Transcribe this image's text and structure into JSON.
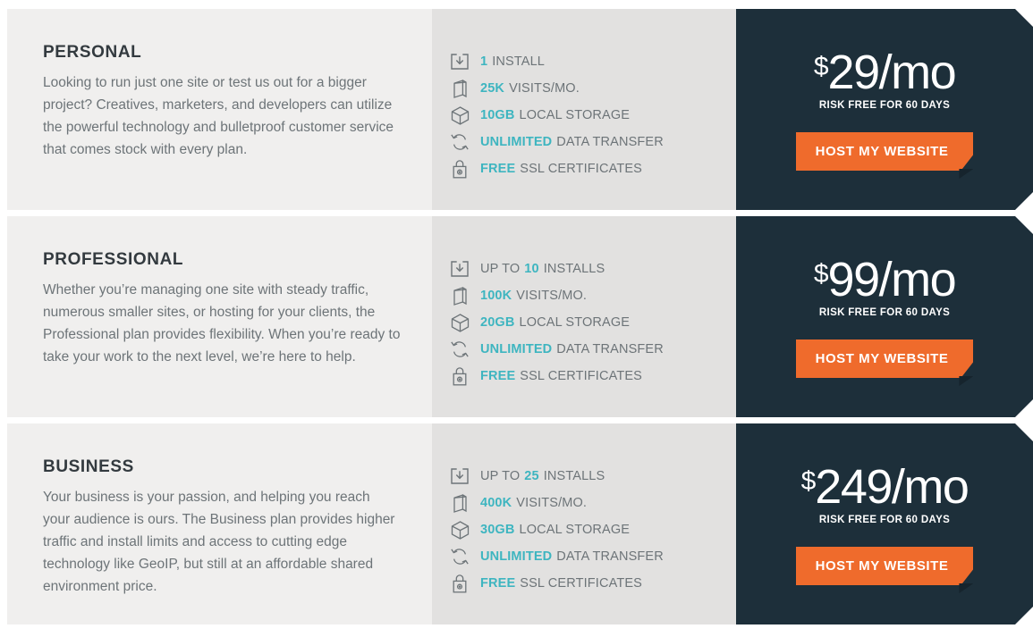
{
  "colors": {
    "desc_bg": "#f0efee",
    "features_bg": "#e2e1e0",
    "price_bg": "#1d2f3a",
    "accent_teal": "#3eb5c0",
    "accent_orange": "#ef6b2c",
    "heading": "#333a3f",
    "body_text": "#6d7478"
  },
  "plans": [
    {
      "name": "PERSONAL",
      "description": "Looking to run just one site or test us out for a bigger project? Creatives, marketers, and developers can utilize the powerful technology and bulletproof customer service that comes stock with every plan.",
      "features": [
        {
          "icon": "download-icon",
          "prefix": "",
          "highlight": "1",
          "rest": "INSTALL"
        },
        {
          "icon": "server-icon",
          "prefix": "",
          "highlight": "25K",
          "rest": "VISITS/MO."
        },
        {
          "icon": "cube-icon",
          "prefix": "",
          "highlight": "10GB",
          "rest": "LOCAL STORAGE"
        },
        {
          "icon": "refresh-icon",
          "prefix": "",
          "highlight": "UNLIMITED",
          "rest": "DATA TRANSFER"
        },
        {
          "icon": "lock-icon",
          "prefix": "",
          "highlight": "FREE",
          "rest": "SSL CERTIFICATES"
        }
      ],
      "currency": "$",
      "price": "29/mo",
      "guarantee": "RISK FREE FOR 60 DAYS",
      "cta_label": "HOST MY WEBSITE"
    },
    {
      "name": "PROFESSIONAL",
      "description": "Whether you’re managing one site with steady traffic, numerous smaller sites, or hosting for your clients, the Professional plan provides flexibility. When you’re ready to take your work to the next level, we’re here to help.",
      "features": [
        {
          "icon": "download-icon",
          "prefix": "UP TO",
          "highlight": "10",
          "rest": "INSTALLS"
        },
        {
          "icon": "server-icon",
          "prefix": "",
          "highlight": "100K",
          "rest": "VISITS/MO."
        },
        {
          "icon": "cube-icon",
          "prefix": "",
          "highlight": "20GB",
          "rest": "LOCAL STORAGE"
        },
        {
          "icon": "refresh-icon",
          "prefix": "",
          "highlight": "UNLIMITED",
          "rest": "DATA TRANSFER"
        },
        {
          "icon": "lock-icon",
          "prefix": "",
          "highlight": "FREE",
          "rest": "SSL CERTIFICATES"
        }
      ],
      "currency": "$",
      "price": "99/mo",
      "guarantee": "RISK FREE FOR 60 DAYS",
      "cta_label": "HOST MY WEBSITE"
    },
    {
      "name": "BUSINESS",
      "description": "Your business is your passion, and helping you reach your audience is ours. The Business plan provides higher traffic and install limits and access to cutting edge technology like GeoIP, but still at an affordable shared environment price.",
      "features": [
        {
          "icon": "download-icon",
          "prefix": "UP TO",
          "highlight": "25",
          "rest": "INSTALLS"
        },
        {
          "icon": "server-icon",
          "prefix": "",
          "highlight": "400K",
          "rest": "VISITS/MO."
        },
        {
          "icon": "cube-icon",
          "prefix": "",
          "highlight": "30GB",
          "rest": "LOCAL STORAGE"
        },
        {
          "icon": "refresh-icon",
          "prefix": "",
          "highlight": "UNLIMITED",
          "rest": "DATA TRANSFER"
        },
        {
          "icon": "lock-icon",
          "prefix": "",
          "highlight": "FREE",
          "rest": "SSL CERTIFICATES"
        }
      ],
      "currency": "$",
      "price": "249/mo",
      "guarantee": "RISK FREE FOR 60 DAYS",
      "cta_label": "HOST MY WEBSITE"
    }
  ]
}
